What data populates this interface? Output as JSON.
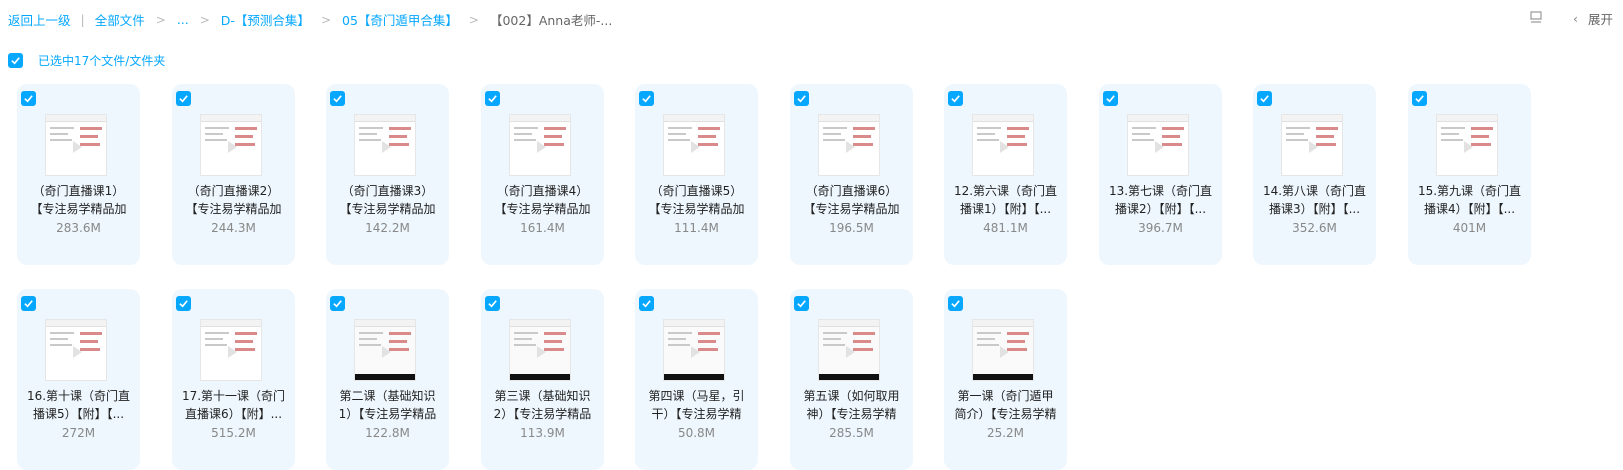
{
  "toolbar": {
    "back": "返回上一级",
    "divider": "|",
    "crumbs": [
      "全部文件",
      "...",
      "D-【预测合集】",
      "05【奇门遁甲合集】",
      "【002】Anna老师-..."
    ],
    "expand_label": "展开",
    "icons": [
      "list-view-icon",
      "chevron-left-icon"
    ]
  },
  "selection": {
    "label": "已选中17个文件/文件夹",
    "checked": true
  },
  "accent_color": "#06a7ff",
  "files": [
    {
      "line1": "（奇门直播课1）",
      "line2": "【专注易学精品加",
      "size": "283.6M"
    },
    {
      "line1": "（奇门直播课2）",
      "line2": "【专注易学精品加",
      "size": "244.3M"
    },
    {
      "line1": "（奇门直播课3）",
      "line2": "【专注易学精品加",
      "size": "142.2M"
    },
    {
      "line1": "（奇门直播课4）",
      "line2": "【专注易学精品加",
      "size": "161.4M"
    },
    {
      "line1": "（奇门直播课5）",
      "line2": "【专注易学精品加",
      "size": "111.4M"
    },
    {
      "line1": "（奇门直播课6）",
      "line2": "【专注易学精品加",
      "size": "196.5M"
    },
    {
      "line1": "12.第六课（奇门直",
      "line2": "播课1）【附】【...",
      "size": "481.1M"
    },
    {
      "line1": "13.第七课（奇门直",
      "line2": "播课2）【附】【...",
      "size": "396.7M"
    },
    {
      "line1": "14.第八课（奇门直",
      "line2": "播课3）【附】【...",
      "size": "352.6M"
    },
    {
      "line1": "15.第九课（奇门直",
      "line2": "播课4）【附】【...",
      "size": "401M"
    },
    {
      "line1": "16.第十课（奇门直",
      "line2": "播课5）【附】【...",
      "size": "272M"
    },
    {
      "line1": "17.第十一课（奇门",
      "line2": "直播课6）【附】...",
      "size": "515.2M"
    },
    {
      "line1": "第二课（基础知识",
      "line2": "1）【专注易学精品",
      "size": "122.8M"
    },
    {
      "line1": "第三课（基础知识",
      "line2": "2）【专注易学精品",
      "size": "113.9M"
    },
    {
      "line1": "第四课（马星，引",
      "line2": "干）【专注易学精",
      "size": "50.8M"
    },
    {
      "line1": "第五课（如何取用",
      "line2": "神）【专注易学精",
      "size": "285.5M"
    },
    {
      "line1": "第一课（奇门遁甲",
      "line2": "简介）【专注易学精",
      "size": "25.2M"
    }
  ]
}
